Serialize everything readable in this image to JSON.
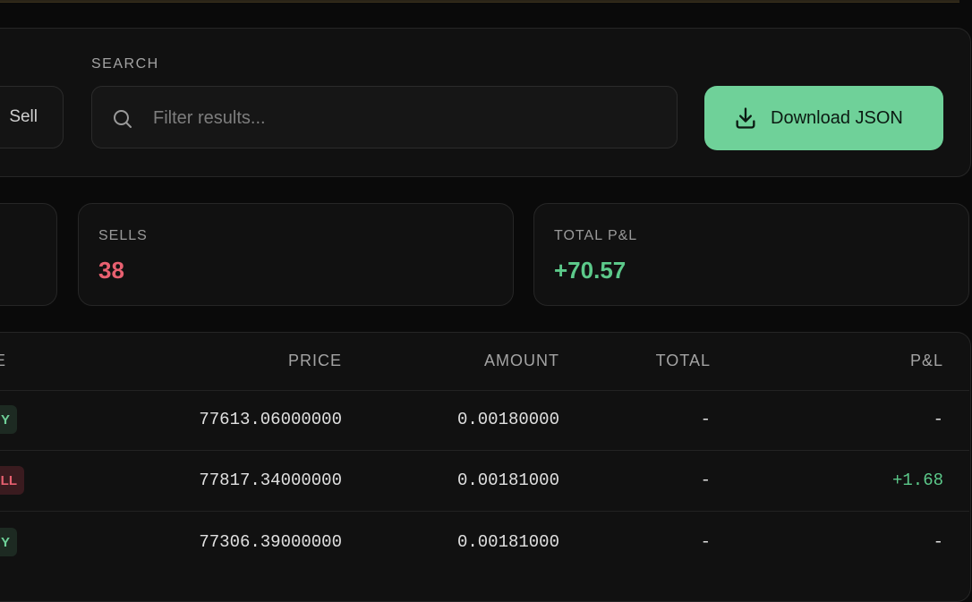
{
  "filters": {
    "side_option_sell": "Sell",
    "search_label": "SEARCH",
    "search_placeholder": "Filter results...",
    "download_label": "Download JSON"
  },
  "stats": {
    "sells_label": "SELLS",
    "sells_value": "38",
    "pnl_label": "TOTAL P&L",
    "pnl_value": "+70.57"
  },
  "table": {
    "headers": {
      "side": "E",
      "price": "PRICE",
      "amount": "AMOUNT",
      "total": "TOTAL",
      "pnl": "P&L"
    },
    "rows": [
      {
        "side": "Y",
        "side_type": "buy",
        "price": "77613.06000000",
        "amount": "0.00180000",
        "total": "-",
        "pnl": "-"
      },
      {
        "side": "LL",
        "side_type": "sell",
        "price": "77817.34000000",
        "amount": "0.00181000",
        "total": "-",
        "pnl": "+1.68"
      },
      {
        "side": "Y",
        "side_type": "buy",
        "price": "77306.39000000",
        "amount": "0.00181000",
        "total": "-",
        "pnl": "-"
      }
    ]
  },
  "colors": {
    "accent_green": "#6fd199",
    "sell_red": "#e86070",
    "pnl_green": "#5cc98a"
  },
  "icons": {
    "search": "search-icon",
    "download": "download-icon"
  }
}
